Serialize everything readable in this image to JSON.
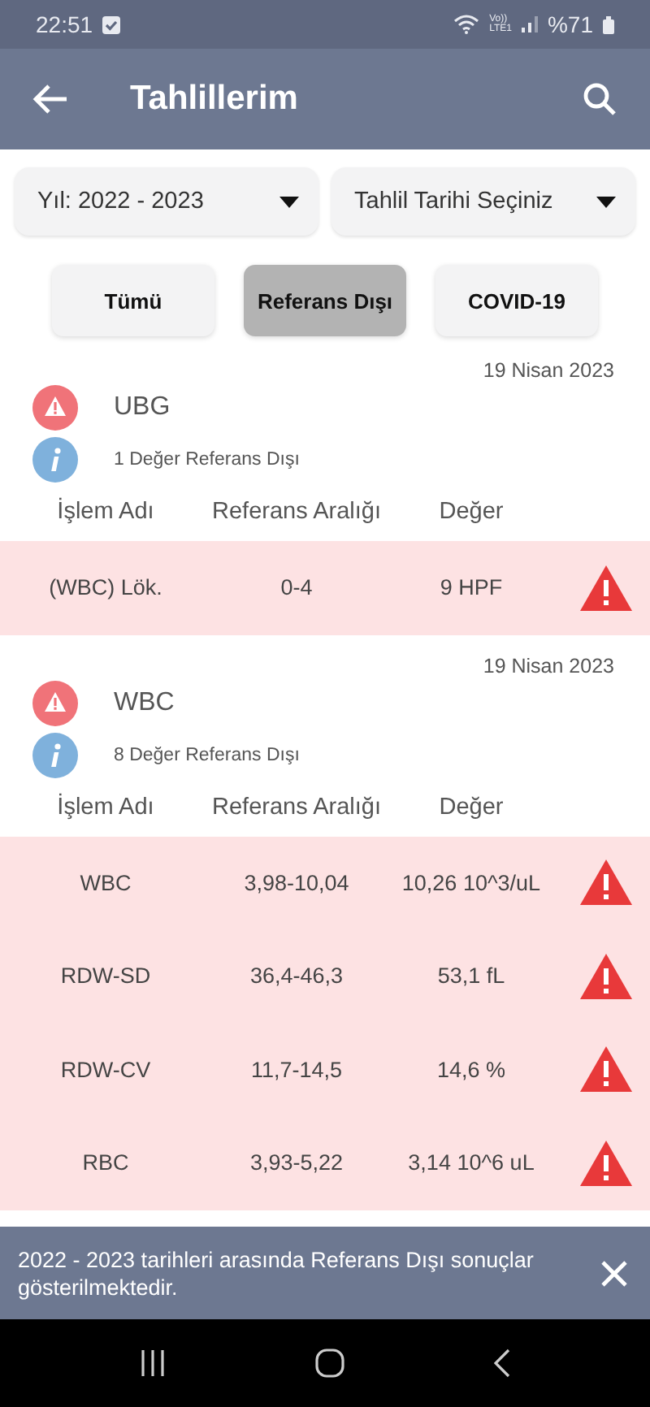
{
  "status_bar": {
    "time": "22:51",
    "volte": "Vo))",
    "network": "LTE1",
    "battery": "%71"
  },
  "app_bar": {
    "title": "Tahlillerim"
  },
  "filters": [
    {
      "value": "Yıl: 2022 - 2023"
    },
    {
      "value": "Tahlil Tarihi Seçiniz"
    }
  ],
  "tabs": [
    {
      "label": "Tümü",
      "selected": false
    },
    {
      "label": "Referans Dışı",
      "selected": true
    },
    {
      "label": "COVID-19",
      "selected": false
    }
  ],
  "results": [
    {
      "date": "19 Nisan 2023",
      "title": "UBG",
      "summary": "1 Değer Referans Dışı",
      "columns": [
        "İşlem Adı",
        "Referans Aralığı",
        "Değer"
      ],
      "rows": [
        {
          "name": "(WBC) Lök.",
          "range": "0-4",
          "value": "9 HPF",
          "out_of_range": true
        }
      ]
    },
    {
      "date": "19 Nisan 2023",
      "title": "WBC",
      "summary": "8 Değer Referans Dışı",
      "columns": [
        "İşlem Adı",
        "Referans Aralığı",
        "Değer"
      ],
      "rows": [
        {
          "name": "WBC",
          "range": "3,98-10,04",
          "value": "10,26 10^3/uL",
          "out_of_range": true
        },
        {
          "name": "RDW-SD",
          "range": "36,4-46,3",
          "value": "53,1 fL",
          "out_of_range": true
        },
        {
          "name": "RDW-CV",
          "range": "11,7-14,5",
          "value": "14,6 %",
          "out_of_range": true
        },
        {
          "name": "RBC",
          "range": "3,93-5,22",
          "value": "3,14 10^6 uL",
          "out_of_range": true
        }
      ]
    }
  ],
  "snackbar": {
    "message": "2022 - 2023 tarihleri arasında Referans Dışı sonuçlar gösterilmektedir."
  }
}
